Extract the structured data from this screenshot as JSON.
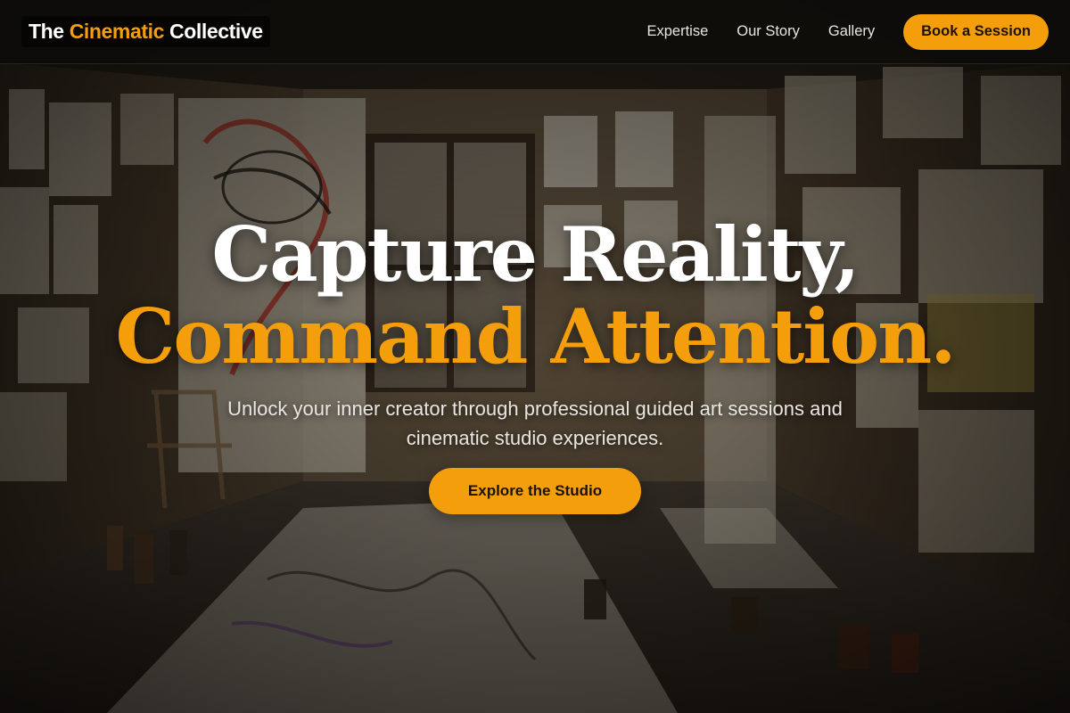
{
  "brand": {
    "prefix": "The ",
    "accent": "Cinematic",
    "suffix": " Collective"
  },
  "nav": {
    "links": [
      "Expertise",
      "Our Story",
      "Gallery"
    ],
    "cta_label": "Book a Session"
  },
  "hero": {
    "headline_line1": "Capture Reality,",
    "headline_line2": "Command Attention.",
    "subtitle": "Unlock your inner creator through professional guided art sessions and cinematic studio experiences.",
    "cta_label": "Explore the Studio"
  },
  "colors": {
    "accent": "#f59e0b",
    "nav_bg": "#0e0c0a",
    "text_light": "#ffffff"
  },
  "background": {
    "description_icon": "art-studio-photo"
  }
}
